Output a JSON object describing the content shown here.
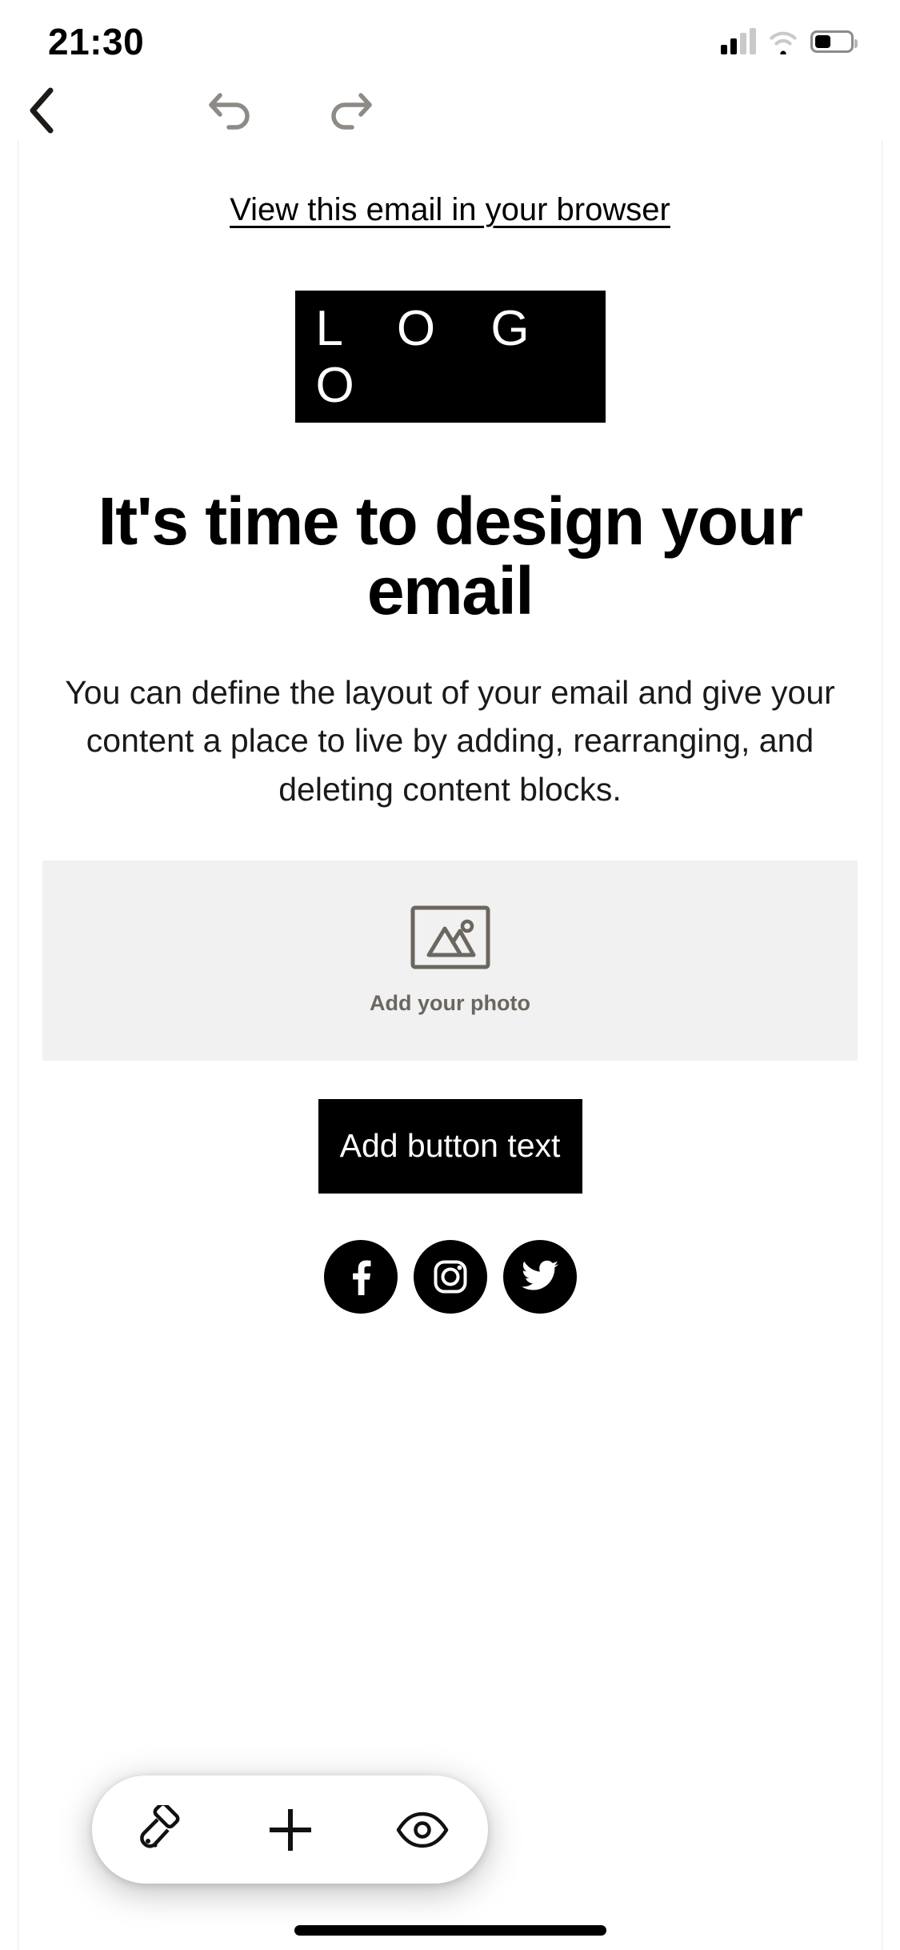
{
  "status_bar": {
    "time": "21:30",
    "signal_icon": "cellular-signal-icon",
    "wifi_icon": "wifi-icon",
    "battery_icon": "battery-icon"
  },
  "nav_bar": {
    "back_icon": "chevron-left-icon",
    "undo_icon": "undo-arrow-icon",
    "redo_icon": "redo-arrow-icon"
  },
  "email": {
    "browser_link": "View this email in your browser",
    "logo_text": "L O G O",
    "headline": "It's time to design your email",
    "body": "You can define the layout of your email and give your content a place to live by adding, rearranging, and deleting content blocks.",
    "photo_placeholder": {
      "icon": "image-placeholder-icon",
      "label": "Add your photo"
    },
    "cta_label": "Add button text",
    "social": [
      {
        "name": "facebook",
        "icon": "facebook-icon"
      },
      {
        "name": "instagram",
        "icon": "instagram-icon"
      },
      {
        "name": "twitter",
        "icon": "twitter-icon"
      }
    ]
  },
  "toolbar": {
    "style_icon": "paint-roller-icon",
    "add_icon": "plus-icon",
    "preview_icon": "eye-icon"
  },
  "colors": {
    "accent": "#000000",
    "canvas": "#ffffff",
    "placeholder_bg": "#f1f1f1",
    "placeholder_stroke": "#6b6760",
    "muted_icon": "#8e8a85"
  }
}
